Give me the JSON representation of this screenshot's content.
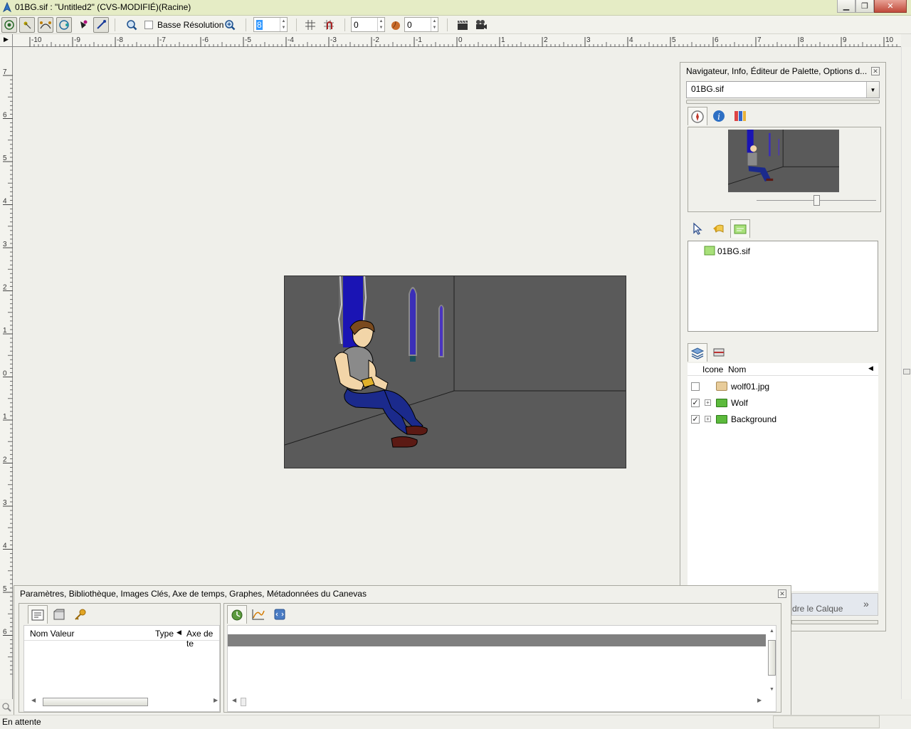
{
  "window": {
    "title": "01BG.sif : \"Untitled2\" (CVS-MODIFIÉ)(Racine)"
  },
  "toolbar": {
    "low_res_label": "Basse Résolution",
    "quality_value": "8",
    "frame_value_1": "0",
    "frame_value_2": "0"
  },
  "ruler": {
    "h_labels": [
      "-10",
      "-9",
      "-8",
      "-7",
      "-6",
      "-5",
      "-4",
      "-3",
      "-2",
      "-1",
      "0",
      "1",
      "2",
      "3",
      "4",
      "5",
      "6",
      "7",
      "8",
      "9",
      "10"
    ],
    "v_labels": [
      "7",
      "6",
      "5",
      "4",
      "3",
      "2",
      "1",
      "0",
      "1",
      "2",
      "3",
      "4",
      "5",
      "6"
    ]
  },
  "navigator": {
    "title": "Navigateur, Info, Éditeur de Palette, Options d...",
    "document_select": "01BG.sif",
    "canvas_tree_item": "01BG.sif",
    "layers_header_icon": "Icone",
    "layers_header_name": "Nom",
    "layers": [
      {
        "name": "wolf01.jpg",
        "checked": false,
        "expandable": false,
        "icon": "image-layer-icon"
      },
      {
        "name": "Wolf",
        "checked": true,
        "expandable": true,
        "icon": "group-folder-icon"
      },
      {
        "name": "Background",
        "checked": true,
        "expandable": true,
        "icon": "group-folder-icon"
      }
    ],
    "bottom_button_partial": "dre le Calque",
    "more_label": "»"
  },
  "params": {
    "title": "Paramètres, Bibliothèque, Images Clés, Axe de temps, Graphes, Métadonnées du Canevas",
    "col_name_value": "Nom Valeur",
    "col_type": "Type",
    "col_timeline": "Axe de te"
  },
  "status": {
    "text": "En attente"
  },
  "colors": {
    "titlebar": "#e5ecc5",
    "canvas_bg": "#5a5a5a",
    "accent_blue": "#1a14b4"
  }
}
